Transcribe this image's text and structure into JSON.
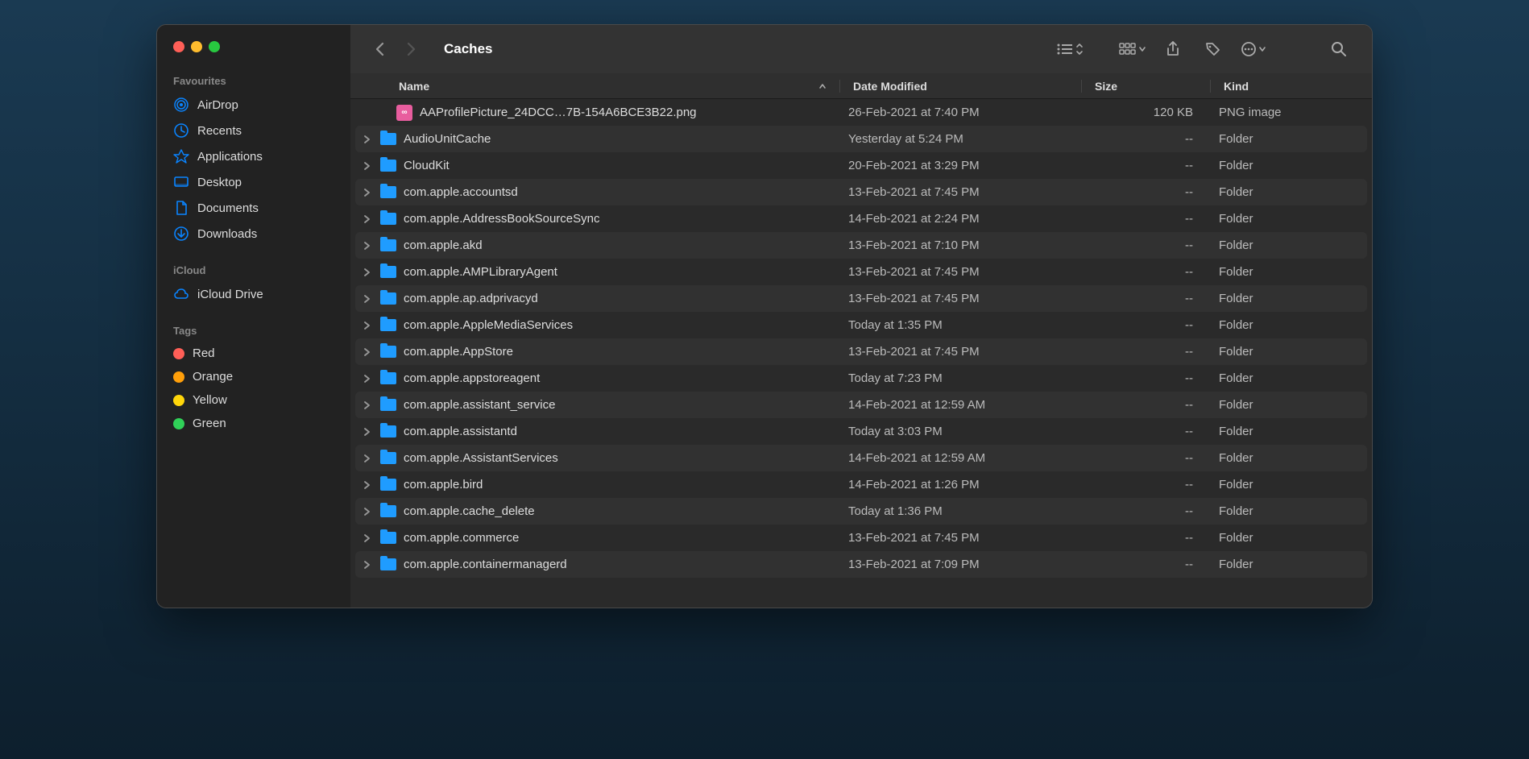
{
  "window": {
    "title": "Caches"
  },
  "sidebar": {
    "sections": [
      {
        "header": "Favourites",
        "items": [
          {
            "icon": "airdrop",
            "label": "AirDrop"
          },
          {
            "icon": "clock",
            "label": "Recents"
          },
          {
            "icon": "apps",
            "label": "Applications"
          },
          {
            "icon": "desktop",
            "label": "Desktop"
          },
          {
            "icon": "document",
            "label": "Documents"
          },
          {
            "icon": "download",
            "label": "Downloads"
          }
        ]
      },
      {
        "header": "iCloud",
        "items": [
          {
            "icon": "cloud",
            "label": "iCloud Drive"
          }
        ]
      },
      {
        "header": "Tags",
        "items": [
          {
            "icon": "tag",
            "color": "#ff5f57",
            "label": "Red"
          },
          {
            "icon": "tag",
            "color": "#ff9f0a",
            "label": "Orange"
          },
          {
            "icon": "tag",
            "color": "#ffd60a",
            "label": "Yellow"
          },
          {
            "icon": "tag",
            "color": "#30d158",
            "label": "Green"
          }
        ]
      }
    ]
  },
  "columns": {
    "name": "Name",
    "date": "Date Modified",
    "size": "Size",
    "kind": "Kind"
  },
  "files": [
    {
      "disclosure": false,
      "type": "png",
      "name": "AAProfilePicture_24DCC…7B-154A6BCE3B22.png",
      "date": "26-Feb-2021 at 7:40 PM",
      "size": "120 KB",
      "kind": "PNG image"
    },
    {
      "disclosure": true,
      "type": "folder",
      "name": "AudioUnitCache",
      "date": "Yesterday at 5:24 PM",
      "size": "--",
      "kind": "Folder"
    },
    {
      "disclosure": true,
      "type": "folder",
      "name": "CloudKit",
      "date": "20-Feb-2021 at 3:29 PM",
      "size": "--",
      "kind": "Folder"
    },
    {
      "disclosure": true,
      "type": "folder",
      "name": "com.apple.accountsd",
      "date": "13-Feb-2021 at 7:45 PM",
      "size": "--",
      "kind": "Folder"
    },
    {
      "disclosure": true,
      "type": "folder",
      "name": "com.apple.AddressBookSourceSync",
      "date": "14-Feb-2021 at 2:24 PM",
      "size": "--",
      "kind": "Folder"
    },
    {
      "disclosure": true,
      "type": "folder",
      "name": "com.apple.akd",
      "date": "13-Feb-2021 at 7:10 PM",
      "size": "--",
      "kind": "Folder"
    },
    {
      "disclosure": true,
      "type": "folder",
      "name": "com.apple.AMPLibraryAgent",
      "date": "13-Feb-2021 at 7:45 PM",
      "size": "--",
      "kind": "Folder"
    },
    {
      "disclosure": true,
      "type": "folder",
      "name": "com.apple.ap.adprivacyd",
      "date": "13-Feb-2021 at 7:45 PM",
      "size": "--",
      "kind": "Folder"
    },
    {
      "disclosure": true,
      "type": "folder",
      "name": "com.apple.AppleMediaServices",
      "date": "Today at 1:35 PM",
      "size": "--",
      "kind": "Folder"
    },
    {
      "disclosure": true,
      "type": "folder",
      "name": "com.apple.AppStore",
      "date": "13-Feb-2021 at 7:45 PM",
      "size": "--",
      "kind": "Folder"
    },
    {
      "disclosure": true,
      "type": "folder",
      "name": "com.apple.appstoreagent",
      "date": "Today at 7:23 PM",
      "size": "--",
      "kind": "Folder"
    },
    {
      "disclosure": true,
      "type": "folder",
      "name": "com.apple.assistant_service",
      "date": "14-Feb-2021 at 12:59 AM",
      "size": "--",
      "kind": "Folder"
    },
    {
      "disclosure": true,
      "type": "folder",
      "name": "com.apple.assistantd",
      "date": "Today at 3:03 PM",
      "size": "--",
      "kind": "Folder"
    },
    {
      "disclosure": true,
      "type": "folder",
      "name": "com.apple.AssistantServices",
      "date": "14-Feb-2021 at 12:59 AM",
      "size": "--",
      "kind": "Folder"
    },
    {
      "disclosure": true,
      "type": "folder",
      "name": "com.apple.bird",
      "date": "14-Feb-2021 at 1:26 PM",
      "size": "--",
      "kind": "Folder"
    },
    {
      "disclosure": true,
      "type": "folder",
      "name": "com.apple.cache_delete",
      "date": "Today at 1:36 PM",
      "size": "--",
      "kind": "Folder"
    },
    {
      "disclosure": true,
      "type": "folder",
      "name": "com.apple.commerce",
      "date": "13-Feb-2021 at 7:45 PM",
      "size": "--",
      "kind": "Folder"
    },
    {
      "disclosure": true,
      "type": "folder",
      "name": "com.apple.containermanagerd",
      "date": "13-Feb-2021 at 7:09 PM",
      "size": "--",
      "kind": "Folder"
    }
  ]
}
